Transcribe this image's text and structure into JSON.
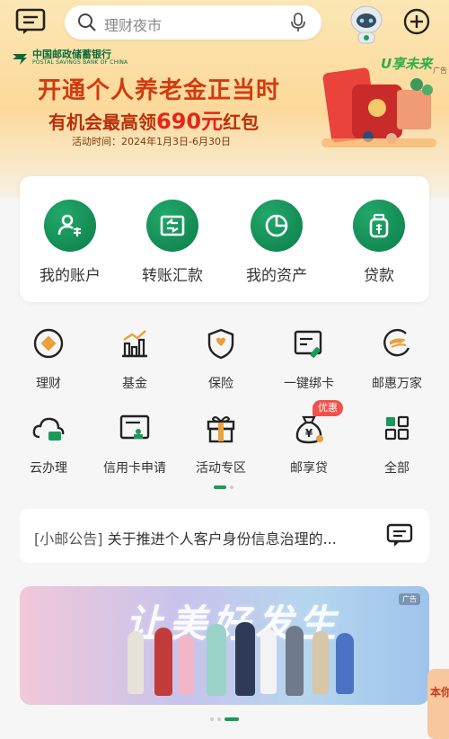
{
  "search": {
    "placeholder": "理财夜市"
  },
  "banner": {
    "bank_name": "中国邮政储蓄银行",
    "bank_name_en": "POSTAL SAVINGS BANK OF CHINA",
    "headline": "开通个人养老金正当时",
    "subline_prefix": "有机会最高领",
    "subline_amount": "690元",
    "subline_suffix": "红包",
    "period": "活动时间：2024年1月3日-6月30日",
    "brand": "U享未来",
    "ad_mark": "广告"
  },
  "main_actions": [
    {
      "label": "我的账户",
      "icon": "account-icon"
    },
    {
      "label": "转账汇款",
      "icon": "transfer-icon"
    },
    {
      "label": "我的资产",
      "icon": "assets-pie-icon"
    },
    {
      "label": "贷款",
      "icon": "loan-bag-icon"
    }
  ],
  "grid_row1": [
    {
      "label": "理财",
      "icon": "wealth-icon"
    },
    {
      "label": "基金",
      "icon": "fund-chart-icon"
    },
    {
      "label": "保险",
      "icon": "insurance-shield-icon"
    },
    {
      "label": "一键绑卡",
      "icon": "bind-card-icon"
    },
    {
      "label": "邮惠万家",
      "icon": "youhui-icon"
    }
  ],
  "grid_row2": [
    {
      "label": "云办理",
      "icon": "cloud-icon"
    },
    {
      "label": "信用卡申请",
      "icon": "credit-card-icon"
    },
    {
      "label": "活动专区",
      "icon": "gift-icon"
    },
    {
      "label": "邮享贷",
      "icon": "money-bag-icon"
    },
    {
      "label": "全部",
      "icon": "all-grid-icon"
    }
  ],
  "badge": "优惠",
  "notice": {
    "tag": "[小邮公告]",
    "text": "关于推进个人客户身份信息治理的..."
  },
  "promo": {
    "title": "让美好发生",
    "ad_mark": "广告"
  },
  "float_badge": "本你",
  "colors": {
    "brand_green": "#0c7d4a",
    "accent_red": "#d23b10",
    "badge_red": "#f0524b"
  }
}
